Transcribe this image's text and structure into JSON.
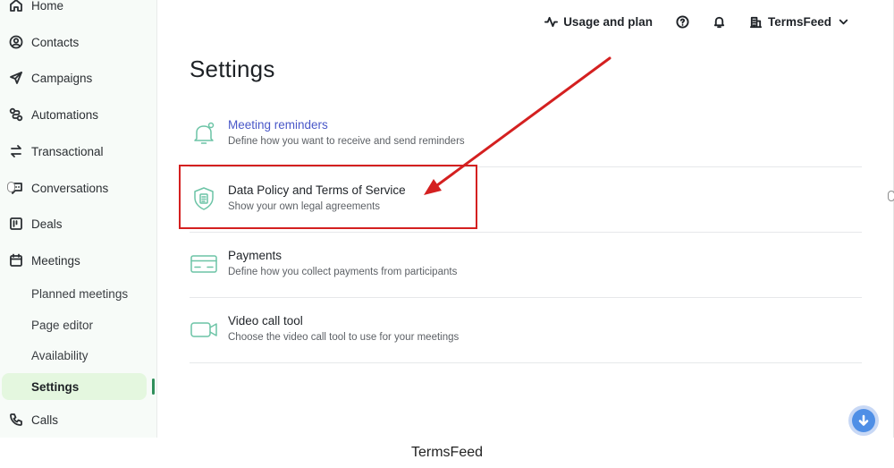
{
  "sidebar": {
    "items": [
      {
        "label": "Home",
        "icon": "home-icon"
      },
      {
        "label": "Contacts",
        "icon": "contacts-icon"
      },
      {
        "label": "Campaigns",
        "icon": "send-icon"
      },
      {
        "label": "Automations",
        "icon": "automation-icon"
      },
      {
        "label": "Transactional",
        "icon": "transfer-icon"
      },
      {
        "label": "Conversations",
        "icon": "chat-icon"
      },
      {
        "label": "Deals",
        "icon": "kanban-icon"
      },
      {
        "label": "Meetings",
        "icon": "calendar-icon"
      }
    ],
    "sub_items": [
      {
        "label": "Planned meetings"
      },
      {
        "label": "Page editor"
      },
      {
        "label": "Availability"
      },
      {
        "label": "Settings",
        "active": true
      }
    ],
    "calls": {
      "label": "Calls",
      "icon": "phone-icon"
    }
  },
  "topbar": {
    "usage_label": "Usage and plan",
    "account_label": "TermsFeed"
  },
  "main": {
    "title": "Settings",
    "rows": [
      {
        "title": "Meeting reminders",
        "description": "Define how you want to receive and send reminders",
        "icon": "bell-icon"
      },
      {
        "title": "Data Policy and Terms of Service",
        "description": "Show your own legal agreements",
        "icon": "shield-document-icon"
      },
      {
        "title": "Payments",
        "description": "Define how you collect payments from participants",
        "icon": "card-icon"
      },
      {
        "title": "Video call tool",
        "description": "Choose the video call tool to use for your meetings",
        "icon": "video-icon"
      }
    ]
  },
  "annotation": {
    "color": "#d42020"
  },
  "colors": {
    "accent": "#6cc4a6",
    "active_bg": "#e4f7df",
    "link": "#4a58c8"
  },
  "footer": {
    "caption": "TermsFeed"
  }
}
